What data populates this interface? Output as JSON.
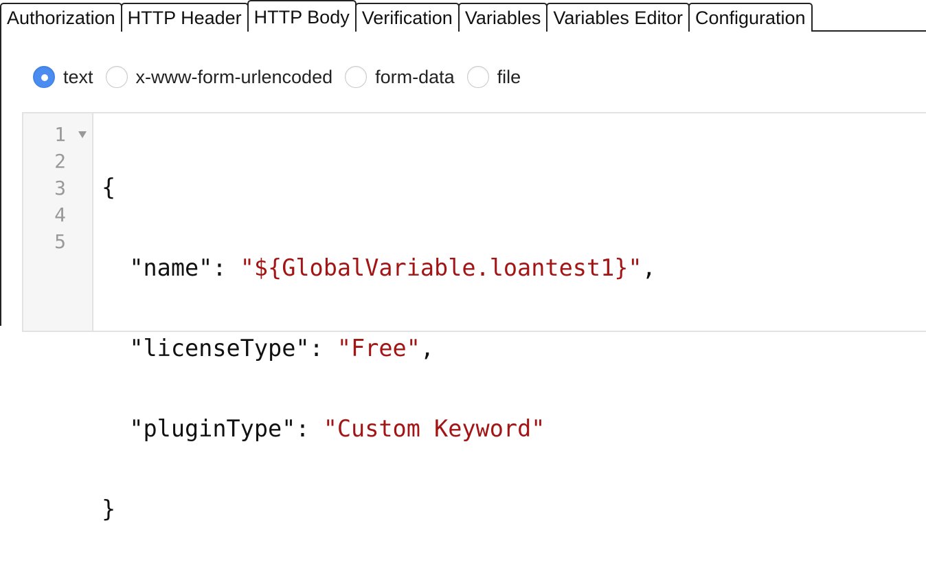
{
  "tabs": [
    {
      "label": "Authorization",
      "active": false
    },
    {
      "label": "HTTP Header",
      "active": false
    },
    {
      "label": "HTTP Body",
      "active": true
    },
    {
      "label": "Verification",
      "active": false
    },
    {
      "label": "Variables",
      "active": false
    },
    {
      "label": "Variables Editor",
      "active": false
    },
    {
      "label": "Configuration",
      "active": false
    }
  ],
  "body_type": {
    "selected": "text",
    "options": [
      "text",
      "x-www-form-urlencoded",
      "form-data",
      "file"
    ]
  },
  "editor": {
    "line_numbers": [
      "1",
      "2",
      "3",
      "4",
      "5"
    ],
    "lines": [
      {
        "pre": "{",
        "str": "",
        "post": ""
      },
      {
        "pre": "  \"name\": ",
        "str": "\"${GlobalVariable.loantest1}\"",
        "post": ","
      },
      {
        "pre": "  \"licenseType\": ",
        "str": "\"Free\"",
        "post": ","
      },
      {
        "pre": "  \"pluginType\": ",
        "str": "\"Custom Keyword\"",
        "post": ""
      },
      {
        "pre": "}",
        "str": "",
        "post": ""
      }
    ]
  },
  "colors": {
    "accent": "#4a8cf0",
    "string": "#a31515",
    "line_number": "#999999"
  }
}
